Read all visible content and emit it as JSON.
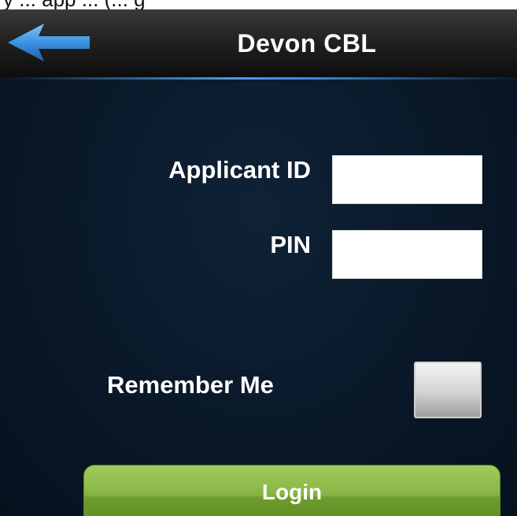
{
  "caption": {
    "text": "y ... app ... (... g"
  },
  "header": {
    "title": "Devon CBL",
    "back_icon": "back-arrow-icon",
    "accent_color": "#4a9be6"
  },
  "form": {
    "applicant_id": {
      "label": "Applicant ID",
      "value": "",
      "placeholder": ""
    },
    "pin": {
      "label": "PIN",
      "value": "",
      "placeholder": ""
    },
    "remember": {
      "label": "Remember Me",
      "checked": false
    }
  },
  "login": {
    "label": "Login",
    "color": "#86b443"
  }
}
